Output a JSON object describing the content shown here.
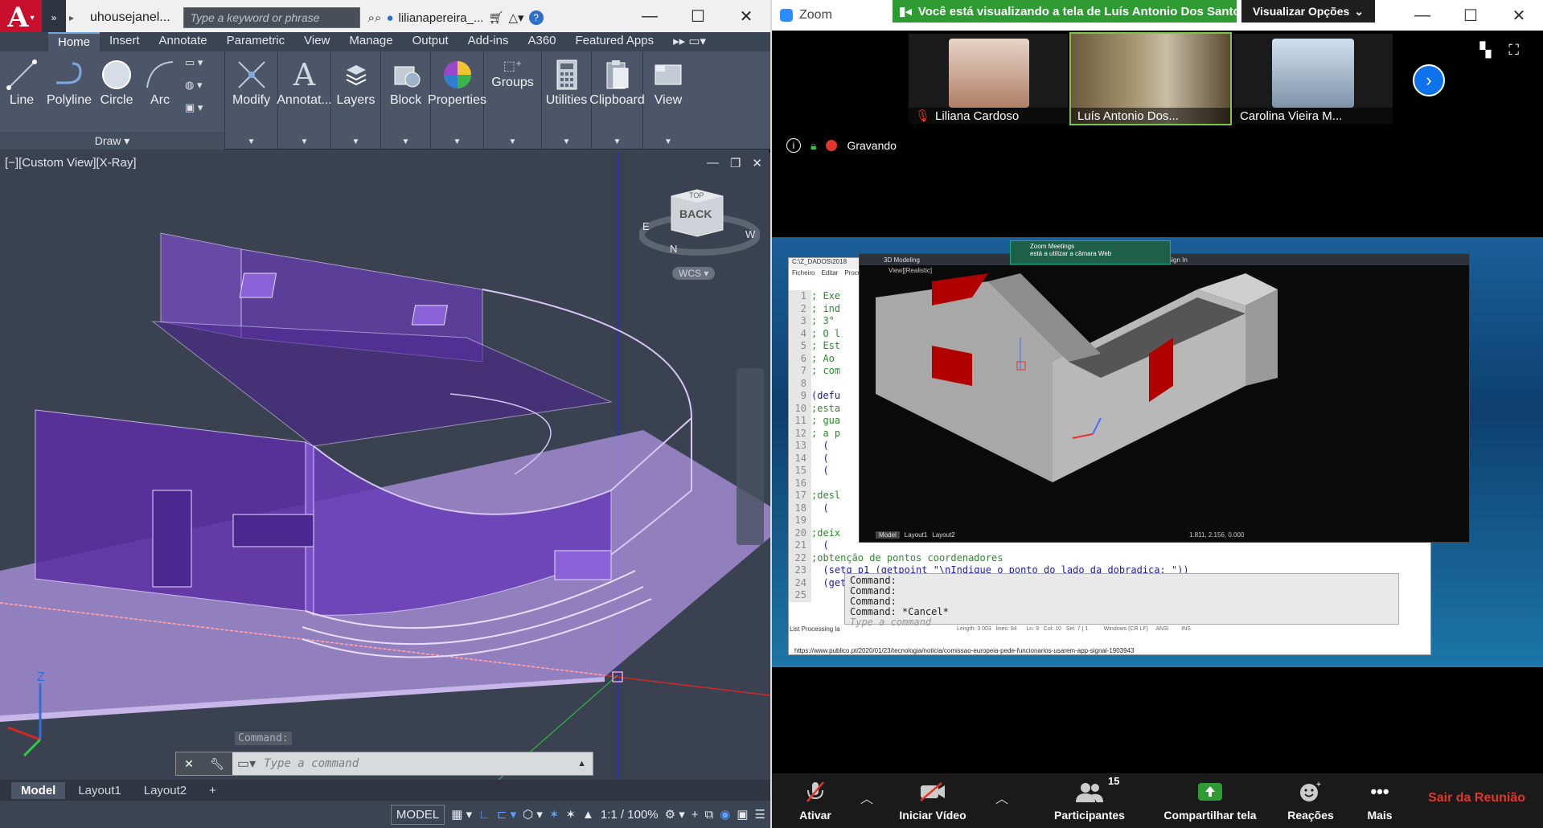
{
  "autocad": {
    "logo": "A",
    "file_tab": "uhousejanel...",
    "search_placeholder": "Type a keyword or phrase",
    "user": "lilianapereira_...",
    "tabs": [
      "Home",
      "Insert",
      "Annotate",
      "Parametric",
      "View",
      "Manage",
      "Output",
      "Add-ins",
      "A360",
      "Featured Apps"
    ],
    "draw_tools": [
      "Line",
      "Polyline",
      "Circle",
      "Arc"
    ],
    "draw_footer": "Draw",
    "ribbon_buttons": [
      "Modify",
      "Annotat...",
      "Layers",
      "Block",
      "Properties",
      "Groups",
      "Utilities",
      "Clipboard",
      "View"
    ],
    "viewport_label": "[−][Custom View][X-Ray]",
    "viewcube_face": "BACK",
    "viewcube_top": "TOP",
    "wcs": "WCS",
    "compass_n": "N",
    "compass_w": "W",
    "compass_e": "E",
    "axis_z": "Z",
    "command_history": "Command:",
    "command_placeholder": "Type a command",
    "layout_tabs": [
      "Model",
      "Layout1",
      "Layout2"
    ],
    "status_model": "MODEL",
    "status_scale": "1:1 / 100%"
  },
  "zoom": {
    "app_name": "Zoom",
    "banner": "Você está visualizando a tela de Luís Antonio Dos Santos o",
    "view_options": "Visualizar Opções",
    "participants_thumbs": [
      {
        "name": "Liliana Cardoso",
        "muted": true
      },
      {
        "name": "Luís Antonio Dos...",
        "muted": false
      },
      {
        "name": "Carolina Vieira M...",
        "muted": false
      }
    ],
    "recording": "Gravando",
    "shared": {
      "path": "C:\\Z_DADOS\\2018",
      "mode": "3D Modeling",
      "sign_in": "Sign In",
      "view_label": "View][Realistic]",
      "notif_title": "Zoom Meetings",
      "notif_body": "está a utilizar a câmara Web",
      "menu": [
        "Ficheiro",
        "Editar",
        "Procur"
      ],
      "code_lines": [
        {
          "n": "1",
          "t": "; Exe"
        },
        {
          "n": "2",
          "t": "; ind"
        },
        {
          "n": "3",
          "t": "; 3°"
        },
        {
          "n": "4",
          "t": "; O l"
        },
        {
          "n": "5",
          "t": "; Est"
        },
        {
          "n": "6",
          "t": "; Ao"
        },
        {
          "n": "7",
          "t": "; com"
        },
        {
          "n": "8",
          "t": ""
        },
        {
          "n": "9",
          "t": "(defu"
        },
        {
          "n": "10",
          "t": ";esta"
        },
        {
          "n": "11",
          "t": "; gua"
        },
        {
          "n": "12",
          "t": "; a p"
        },
        {
          "n": "13",
          "t": "  ("
        },
        {
          "n": "14",
          "t": "  ("
        },
        {
          "n": "15",
          "t": "  ("
        },
        {
          "n": "16",
          "t": ""
        },
        {
          "n": "17",
          "t": ";desl"
        },
        {
          "n": "18",
          "t": "  ("
        },
        {
          "n": "19",
          "t": ""
        },
        {
          "n": "20",
          "t": ";deix"
        },
        {
          "n": "21",
          "t": "  ("
        },
        {
          "n": "22",
          "t": ";obtenção de pontos coordenadores"
        },
        {
          "n": "23",
          "t": "  (setq p1 (getpoint \"\\nIndique o ponto do lado da dobradiça: \"))"
        },
        {
          "n": "24",
          "t": "  (getpoint \"\\nIndique o ponto do lado onde é o batente: \"))"
        },
        {
          "n": "25",
          "t": ""
        }
      ],
      "commands": [
        "Command:",
        "Command:",
        "Command:",
        "Command: *Cancel*"
      ],
      "cmd_placeholder": "Type a command",
      "layouts": [
        "Model",
        "Layout1",
        "Layout2"
      ],
      "coords": "1.811, 2.156, 0.000",
      "status_bar": "Length: 3 003   lines: 84      Ln: 9   Col: 10   Sel: 7 | 1          Windows (CR LF)     ANSI        INS",
      "list_proc": "List Processing la",
      "url": "https://www.publico.pt/2020/01/23/tecnologia/noticia/comissao-europeia-pede-funcionarios-usarem-app-signal-1903943"
    },
    "toolbar": [
      {
        "label": "Ativar",
        "icon": "mic-muted-icon"
      },
      {
        "label": "Iniciar Vídeo",
        "icon": "video-off-icon"
      },
      {
        "label": "Participantes",
        "icon": "participants-icon",
        "count": "15"
      },
      {
        "label": "Compartilhar tela",
        "icon": "share-icon"
      },
      {
        "label": "Reações",
        "icon": "reactions-icon"
      },
      {
        "label": "Mais",
        "icon": "more-icon"
      }
    ],
    "leave": "Sair da Reunião"
  },
  "colors": {
    "acad_bg": "#3b4453",
    "xray_purple": "#7a4fc9",
    "zoom_green": "#2d9b32",
    "zoom_blue": "#0e72ed",
    "leave_red": "#e0362c"
  }
}
